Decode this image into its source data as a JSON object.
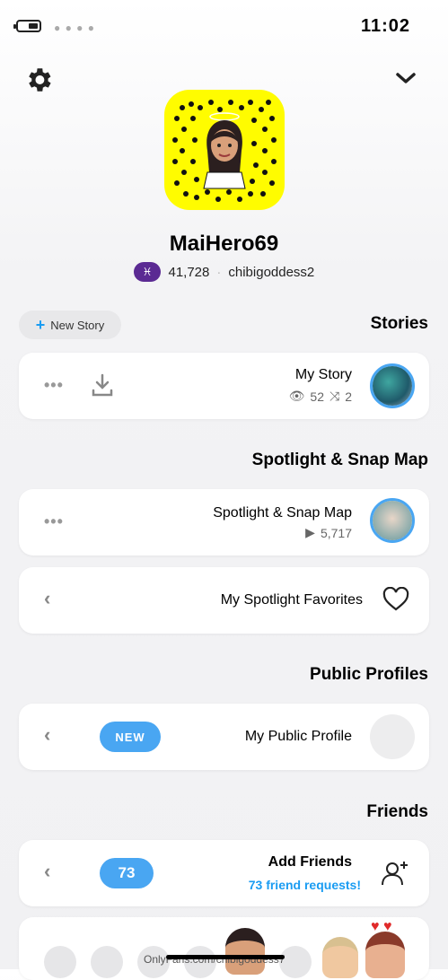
{
  "status_bar": {
    "time": "11:02"
  },
  "profile": {
    "display_name": "MaiHero69",
    "username": "chibigoddess2",
    "snap_score": "41,728",
    "zodiac_glyph": "♓"
  },
  "stories": {
    "section_title": "Stories",
    "new_story_label": "New Story",
    "my_story": {
      "title": "My Story",
      "views": "52",
      "screenshots": "2"
    }
  },
  "spotlight": {
    "section_title": "Spotlight & Snap Map",
    "card_title": "Spotlight & Snap Map",
    "views": "5,717",
    "favorites_label": "My Spotlight Favorites"
  },
  "public_profiles": {
    "section_title": "Public Profiles",
    "card_title": "My Public Profile",
    "badge": "NEW"
  },
  "friends": {
    "section_title": "Friends",
    "add_friends_label": "Add Friends",
    "requests_text": "73 friend requests!",
    "request_count": "73"
  },
  "watermark": "OnlyFans.com/chibigoddess7",
  "colors": {
    "accent": "#49a6f2",
    "snap_yellow": "#fffc00",
    "zodiac": "#5b2a93"
  }
}
